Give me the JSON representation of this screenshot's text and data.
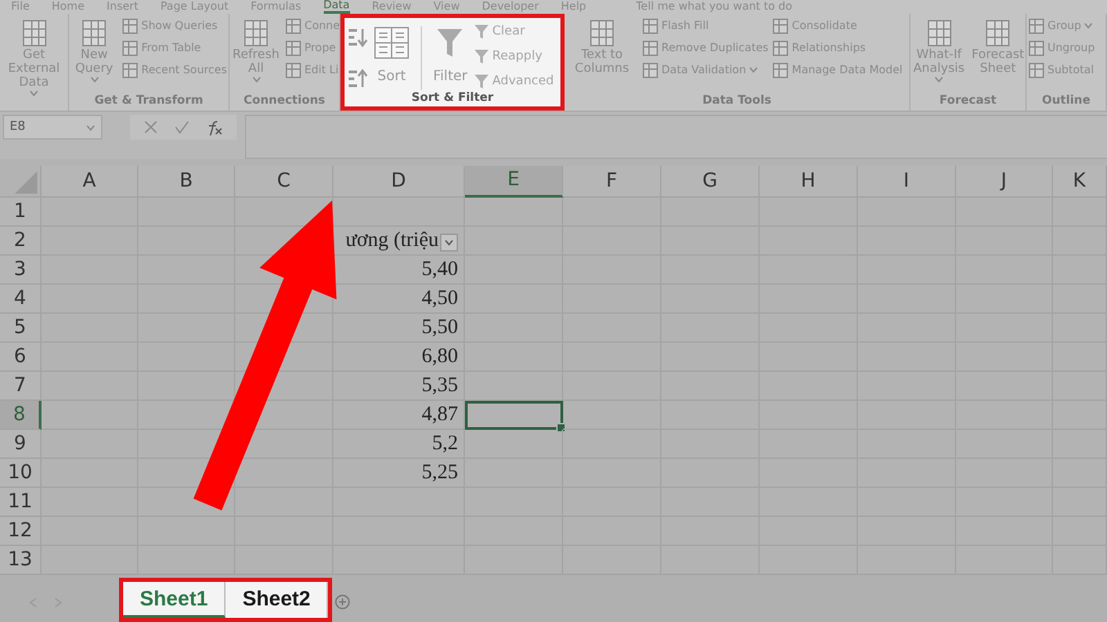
{
  "ribbon_tabs": [
    {
      "label": "File",
      "selected": false
    },
    {
      "label": "Home",
      "selected": false
    },
    {
      "label": "Insert",
      "selected": false
    },
    {
      "label": "Page Layout",
      "selected": false
    },
    {
      "label": "Formulas",
      "selected": false
    },
    {
      "label": "Data",
      "selected": true
    },
    {
      "label": "Review",
      "selected": false
    },
    {
      "label": "View",
      "selected": false
    },
    {
      "label": "Developer",
      "selected": false
    },
    {
      "label": "Help",
      "selected": false
    }
  ],
  "tell_me": "Tell me what you want to do",
  "ribbon_groups": [
    {
      "highlighted": false,
      "items": [
        {
          "kind": "large",
          "label": "Get External Data",
          "dropdown": true
        }
      ]
    },
    {
      "label": "Get & Transform",
      "highlighted": false,
      "items": [
        {
          "kind": "large",
          "label": "New Query",
          "dropdown": true
        },
        {
          "kind": "stack",
          "items": [
            {
              "kind": "small",
              "label": "Show Queries"
            },
            {
              "kind": "small",
              "label": "From Table"
            },
            {
              "kind": "small",
              "label": "Recent Sources"
            }
          ]
        }
      ]
    },
    {
      "label": "Connections",
      "highlighted": false,
      "items": [
        {
          "kind": "large",
          "label": "Refresh All",
          "dropdown": true
        },
        {
          "kind": "stack",
          "items": [
            {
              "kind": "small",
              "label": "Conne"
            },
            {
              "kind": "small",
              "label": "Prope"
            },
            {
              "kind": "small",
              "label": "Edit Li"
            }
          ]
        }
      ]
    },
    {
      "label": "Sort & Filter",
      "highlighted": true,
      "items": [
        {
          "kind": "sort_pair"
        },
        {
          "kind": "large_sort",
          "label": "Sort"
        },
        {
          "kind": "divider"
        },
        {
          "kind": "large_filter",
          "label": "Filter"
        },
        {
          "kind": "stack",
          "items": [
            {
              "kind": "small_filter",
              "label": "Clear"
            },
            {
              "kind": "small_filter",
              "label": "Reapply"
            },
            {
              "kind": "small_filter",
              "label": "Advanced"
            }
          ]
        }
      ]
    },
    {
      "label": "Data Tools",
      "highlighted": false,
      "items": [
        {
          "kind": "large",
          "label": "Text to Columns"
        },
        {
          "kind": "stack",
          "items": [
            {
              "kind": "small",
              "label": "Flash Fill"
            },
            {
              "kind": "small",
              "label": "Remove Duplicates"
            },
            {
              "kind": "small",
              "label": "Data Validation",
              "dropdown": true
            }
          ]
        },
        {
          "kind": "stack",
          "items": [
            {
              "kind": "small",
              "label": "Consolidate"
            },
            {
              "kind": "small",
              "label": "Relationships"
            },
            {
              "kind": "small",
              "label": "Manage Data Model"
            }
          ]
        }
      ]
    },
    {
      "label": "Forecast",
      "highlighted": false,
      "items": [
        {
          "kind": "large",
          "label": "What-If Analysis",
          "dropdown": true
        },
        {
          "kind": "large",
          "label": "Forecast Sheet"
        }
      ]
    },
    {
      "label": "Outline",
      "highlighted": false,
      "items": [
        {
          "kind": "stack",
          "items": [
            {
              "kind": "small",
              "label": "Group",
              "dropdown": true
            },
            {
              "kind": "small",
              "label": "Ungroup"
            },
            {
              "kind": "small",
              "label": "Subtotal"
            }
          ]
        }
      ]
    }
  ],
  "name_box": "E8",
  "columns": [
    {
      "label": "A",
      "selected": false
    },
    {
      "label": "B",
      "selected": false
    },
    {
      "label": "C",
      "selected": false
    },
    {
      "label": "D",
      "selected": false
    },
    {
      "label": "E",
      "selected": true
    },
    {
      "label": "F",
      "selected": false
    },
    {
      "label": "G",
      "selected": false
    },
    {
      "label": "H",
      "selected": false
    },
    {
      "label": "I",
      "selected": false
    },
    {
      "label": "J",
      "selected": false
    },
    {
      "label": "K",
      "selected": false
    }
  ],
  "rows": [
    {
      "label": "1",
      "selected": false
    },
    {
      "label": "2",
      "selected": false,
      "column_d": "ương (triệu",
      "filter_button": true
    },
    {
      "label": "3",
      "selected": false,
      "column_d": "5,40"
    },
    {
      "label": "4",
      "selected": false,
      "column_d": "4,50"
    },
    {
      "label": "5",
      "selected": false,
      "column_d": "5,50"
    },
    {
      "label": "6",
      "selected": false,
      "column_d": "6,80"
    },
    {
      "label": "7",
      "selected": false,
      "column_d": "5,35"
    },
    {
      "label": "8",
      "selected": true,
      "column_d": "4,87"
    },
    {
      "label": "9",
      "selected": false,
      "column_d": "5,2"
    },
    {
      "label": "10",
      "selected": false,
      "column_d": "5,25"
    },
    {
      "label": "11",
      "selected": false
    },
    {
      "label": "12",
      "selected": false
    },
    {
      "label": "13",
      "selected": false
    }
  ],
  "sheet_tabs": {
    "highlighted": true,
    "tabs": [
      {
        "label": "Sheet1",
        "selected": true
      },
      {
        "label": "Sheet2",
        "selected": false
      }
    ]
  }
}
